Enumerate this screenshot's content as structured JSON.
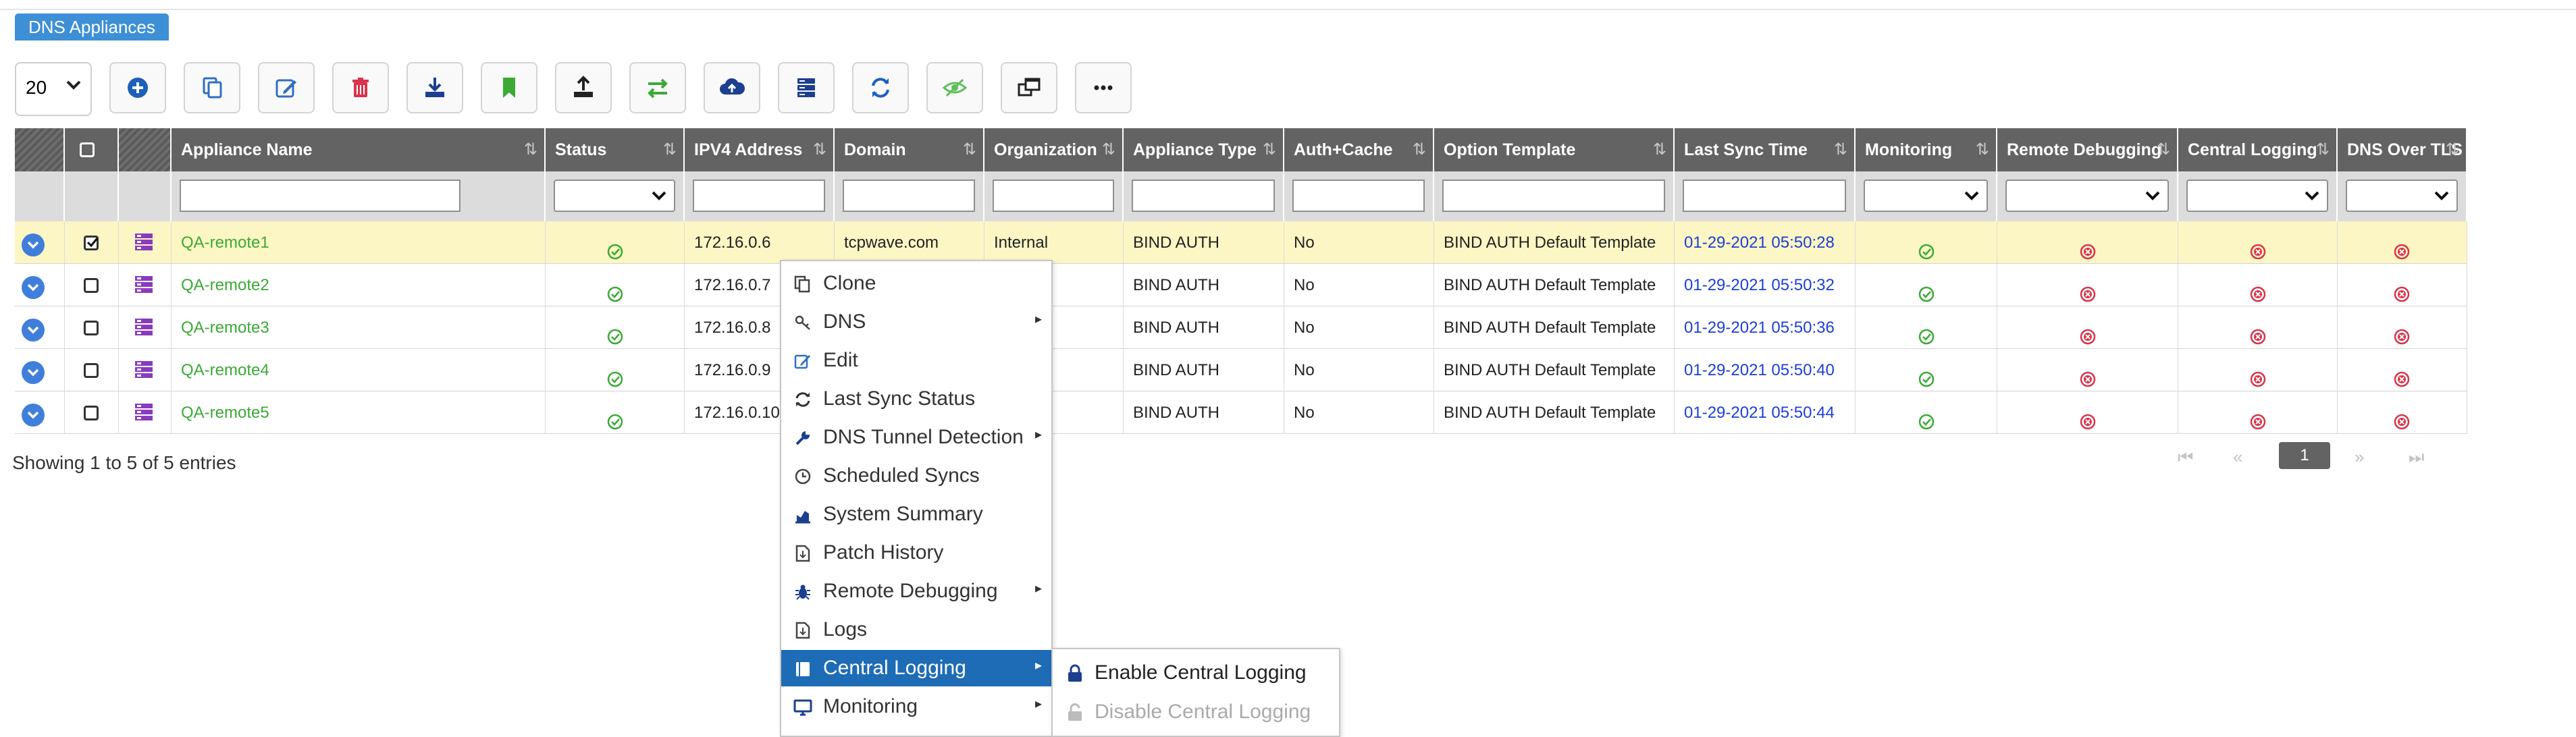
{
  "page": {
    "title": "DNS Appliances"
  },
  "toolbar": {
    "page_size": "20",
    "buttons": [
      "add-icon",
      "copy-icon",
      "edit-icon",
      "delete-icon",
      "import-icon",
      "bookmark-icon",
      "export-icon",
      "transfer-icon",
      "cloud-upload-icon",
      "server-list-icon",
      "refresh-icon",
      "visibility-icon",
      "window-icon",
      "more-icon"
    ]
  },
  "table": {
    "columns": [
      "Appliance Name",
      "Status",
      "IPV4 Address",
      "Domain",
      "Organization",
      "Appliance Type",
      "Auth+Cache",
      "Option Template",
      "Last Sync Time",
      "Monitoring",
      "Remote Debugging",
      "Central Logging",
      "DNS Over TLS"
    ],
    "rows": [
      {
        "name": "QA-remote1",
        "ip": "172.16.0.6",
        "domain": "tcpwave.com",
        "org": "Internal",
        "type": "BIND AUTH",
        "auth": "No",
        "template": "BIND AUTH Default Template",
        "sync": "01-29-2021 05:50:28",
        "checked": true
      },
      {
        "name": "QA-remote2",
        "ip": "172.16.0.7",
        "domain": "",
        "org": "",
        "type": "BIND AUTH",
        "auth": "No",
        "template": "BIND AUTH Default Template",
        "sync": "01-29-2021 05:50:32",
        "checked": false
      },
      {
        "name": "QA-remote3",
        "ip": "172.16.0.8",
        "domain": "",
        "org": "",
        "type": "BIND AUTH",
        "auth": "No",
        "template": "BIND AUTH Default Template",
        "sync": "01-29-2021 05:50:36",
        "checked": false
      },
      {
        "name": "QA-remote4",
        "ip": "172.16.0.9",
        "domain": "",
        "org": "",
        "type": "BIND AUTH",
        "auth": "No",
        "template": "BIND AUTH Default Template",
        "sync": "01-29-2021 05:50:40",
        "checked": false
      },
      {
        "name": "QA-remote5",
        "ip": "172.16.0.10",
        "domain": "",
        "org": "",
        "type": "BIND AUTH",
        "auth": "No",
        "template": "BIND AUTH Default Template",
        "sync": "01-29-2021 05:50:44",
        "checked": false
      }
    ],
    "footer": "Showing 1 to 5 of 5 entries",
    "current_page": "1"
  },
  "context_menu": {
    "items": [
      {
        "label": "Clone",
        "icon": "clone-icon",
        "submenu": false
      },
      {
        "label": "DNS",
        "icon": "dns-key-icon",
        "submenu": true
      },
      {
        "label": "Edit",
        "icon": "edit-icon",
        "submenu": false
      },
      {
        "label": "Last Sync Status",
        "icon": "sync-icon",
        "submenu": false
      },
      {
        "label": "DNS Tunnel Detection",
        "icon": "wrench-icon",
        "submenu": true
      },
      {
        "label": "Scheduled Syncs",
        "icon": "clock-icon",
        "submenu": false
      },
      {
        "label": "System Summary",
        "icon": "chart-icon",
        "submenu": false
      },
      {
        "label": "Patch History",
        "icon": "file-icon",
        "submenu": false
      },
      {
        "label": "Remote Debugging",
        "icon": "bug-icon",
        "submenu": true
      },
      {
        "label": "Logs",
        "icon": "file-icon",
        "submenu": false
      },
      {
        "label": "Central Logging",
        "icon": "book-icon",
        "submenu": true,
        "active": true
      },
      {
        "label": "Monitoring",
        "icon": "monitor-icon",
        "submenu": true
      }
    ],
    "submenu": [
      {
        "label": "Enable Central Logging",
        "icon": "lock-icon",
        "disabled": false
      },
      {
        "label": "Disable Central Logging",
        "icon": "unlock-icon",
        "disabled": true
      }
    ]
  },
  "colors": {
    "accent": "#3d8fd6",
    "header": "#636363",
    "selected_row": "#fcf6c4",
    "menu_active": "#1e6bb6",
    "ok": "#3aaa35",
    "error": "#d9334a",
    "time": "#1b3fd8"
  }
}
